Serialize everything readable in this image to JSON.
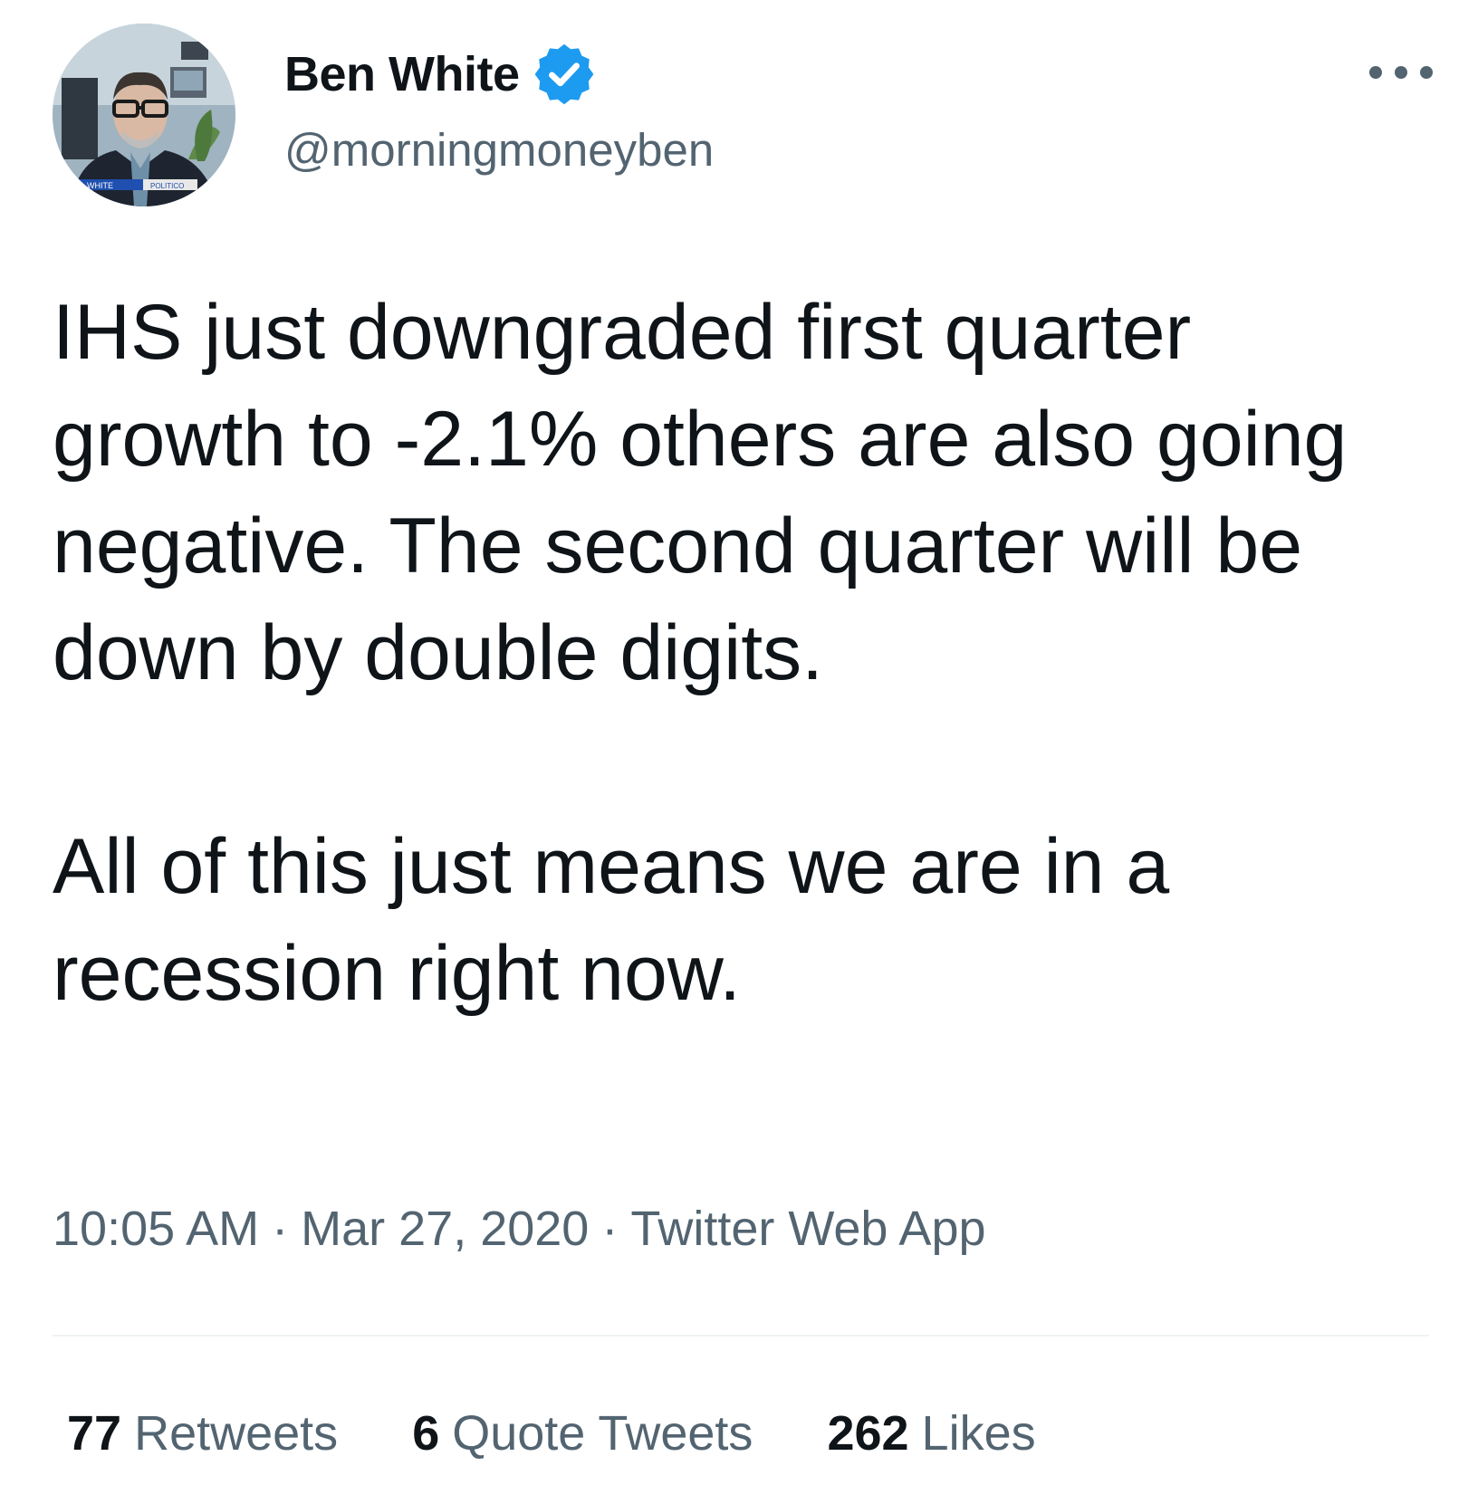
{
  "author": {
    "display_name": "Ben White",
    "handle": "@morningmoneyben",
    "verified": true,
    "avatar_icon": "profile-photo",
    "avatar_caption": "WHITE",
    "avatar_network": "POLITICO"
  },
  "tweet": {
    "paragraphs": [
      "IHS just downgraded first quarter growth to -2.1% others are also going negative. The second quarter will be down by double digits.",
      "All of this just means we are in a recession right now."
    ]
  },
  "meta": {
    "time": "10:05 AM",
    "separator": "·",
    "date": "Mar 27, 2020",
    "source": "Twitter Web App"
  },
  "stats": {
    "retweets_count": "77",
    "retweets_label": "Retweets",
    "quotes_count": "6",
    "quotes_label": "Quote Tweets",
    "likes_count": "262",
    "likes_label": "Likes"
  },
  "colors": {
    "text_primary": "#0f1419",
    "text_secondary": "#536471",
    "verified_badge": "#1d9bf0",
    "divider": "#eff3f4"
  }
}
